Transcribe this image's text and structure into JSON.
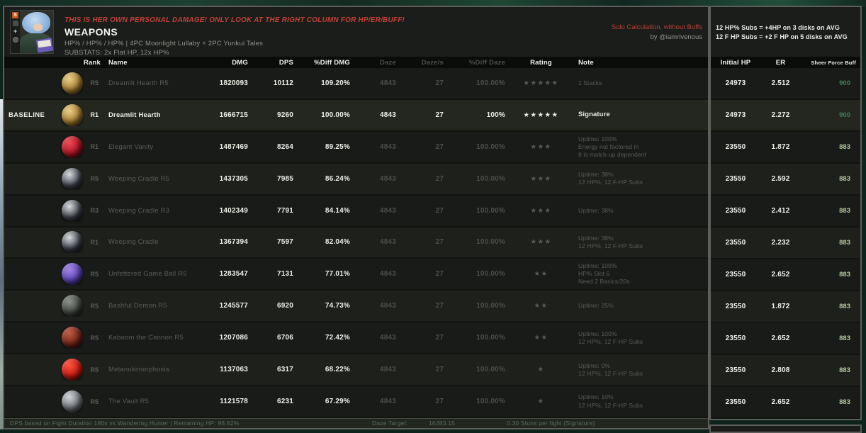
{
  "header": {
    "warning": "THIS IS HER OWN PERSONAL DAMAGE! ONLY LOOK AT THE RIGHT COLUMN FOR HP/ER/BUFF!",
    "title": "WEAPONS",
    "build_line": "HP% / HP% / HP%   |   4PC Moonlight Lullaby + 2PC Yunkui Tales",
    "substats_line": "SUBSTATS: 2x Flat HP, 12x HP%",
    "solo_note": "Solo Calculation, without Buffs",
    "credit": "by @iamrivenous",
    "avatar_badge": "S"
  },
  "right_panel": {
    "notes": [
      "12 HP% Subs = +4HP on 3 disks on AVG",
      "12 F HP Subs = +2 F HP on 5 disks on AVG"
    ],
    "columns": [
      "Initial HP",
      "ER",
      "Sheer Force Buff"
    ]
  },
  "table": {
    "columns": [
      "Rank",
      "Name",
      "DMG",
      "DPS",
      "%Diff DMG",
      "Daze",
      "Daze/s",
      "%Diff Daze",
      "Rating",
      "Note"
    ],
    "baseline_label": "BASELINE",
    "rows": [
      {
        "rank": "R5",
        "name": "Dreamlit Hearth R5",
        "dmg": "1820093",
        "dps": "10112",
        "diff_dmg": "109.20%",
        "daze": "4843",
        "daze_s": "27",
        "diff_daze": "100.00%",
        "stars": 5,
        "note": [
          "1 Stacks"
        ],
        "initial_hp": "24973",
        "er": "2.512",
        "buff": "900",
        "icon": "gold-orb",
        "baseline": false
      },
      {
        "rank": "R1",
        "name": "Dreamlit Hearth",
        "dmg": "1666715",
        "dps": "9260",
        "diff_dmg": "100.00%",
        "daze": "4843",
        "daze_s": "27",
        "diff_daze": "100%",
        "stars": 5,
        "note": [
          "Signature"
        ],
        "initial_hp": "24973",
        "er": "2.272",
        "buff": "900",
        "icon": "gold-orb",
        "baseline": true
      },
      {
        "rank": "R1",
        "name": "Elegant Vanity",
        "dmg": "1487469",
        "dps": "8264",
        "diff_dmg": "89.25%",
        "daze": "4843",
        "daze_s": "27",
        "diff_daze": "100.00%",
        "stars": 3,
        "note": [
          "Uptime: 100%",
          "Energy not factored in",
          "It is match-up dependent"
        ],
        "initial_hp": "23550",
        "er": "1.872",
        "buff": "883",
        "icon": "red-gem",
        "baseline": false
      },
      {
        "rank": "R5",
        "name": "Weeping Cradle R5",
        "dmg": "1437305",
        "dps": "7985",
        "diff_dmg": "86.24%",
        "daze": "4843",
        "daze_s": "27",
        "diff_daze": "100.00%",
        "stars": 3,
        "note": [
          "Uptime: 38%",
          "12 HP%, 12 F-HP Subs"
        ],
        "initial_hp": "23550",
        "er": "2.592",
        "buff": "883",
        "icon": "dark-orb",
        "baseline": false
      },
      {
        "rank": "R3",
        "name": "Weeping Cradle R3",
        "dmg": "1402349",
        "dps": "7791",
        "diff_dmg": "84.14%",
        "daze": "4843",
        "daze_s": "27",
        "diff_daze": "100.00%",
        "stars": 3,
        "note": [
          "Uptime: 38%"
        ],
        "initial_hp": "23550",
        "er": "2.412",
        "buff": "883",
        "icon": "dark-orb",
        "baseline": false
      },
      {
        "rank": "R1",
        "name": "Weeping Cradle",
        "dmg": "1367394",
        "dps": "7597",
        "diff_dmg": "82.04%",
        "daze": "4843",
        "daze_s": "27",
        "diff_daze": "100.00%",
        "stars": 3,
        "note": [
          "Uptime: 38%",
          "12 HP%, 12 F-HP Subs"
        ],
        "initial_hp": "23550",
        "er": "2.232",
        "buff": "883",
        "icon": "dark-orb",
        "baseline": false
      },
      {
        "rank": "R5",
        "name": "Unfettered Game Ball R5",
        "dmg": "1283547",
        "dps": "7131",
        "diff_dmg": "77.01%",
        "daze": "4843",
        "daze_s": "27",
        "diff_daze": "100.00%",
        "stars": 2,
        "note": [
          "Uptime: 100%",
          "HP% Slot 6",
          "Need 2 Basics/20s"
        ],
        "initial_hp": "23550",
        "er": "2.652",
        "buff": "883",
        "icon": "purple-ball",
        "baseline": false
      },
      {
        "rank": "R5",
        "name": "Bashful Demon R5",
        "dmg": "1245577",
        "dps": "6920",
        "diff_dmg": "74.73%",
        "daze": "4843",
        "daze_s": "27",
        "diff_daze": "100.00%",
        "stars": 2,
        "note": [
          "Uptime: 25%"
        ],
        "initial_hp": "23550",
        "er": "1.872",
        "buff": "883",
        "icon": "gray-mech",
        "baseline": false
      },
      {
        "rank": "R5",
        "name": "Kaboom the Cannon R5",
        "dmg": "1207086",
        "dps": "6706",
        "diff_dmg": "72.42%",
        "daze": "4843",
        "daze_s": "27",
        "diff_daze": "100.00%",
        "stars": 2,
        "note": [
          "Uptime: 100%",
          "12 HP%, 12 F-HP Subs"
        ],
        "initial_hp": "23550",
        "er": "2.652",
        "buff": "883",
        "icon": "dark-cannon",
        "baseline": false
      },
      {
        "rank": "R5",
        "name": "Metanukimorphosis",
        "dmg": "1137063",
        "dps": "6317",
        "diff_dmg": "68.22%",
        "daze": "4843",
        "daze_s": "27",
        "diff_daze": "100.00%",
        "stars": 1,
        "note": [
          "Uptime: 0%",
          "12 HP%, 12 F-HP Subs"
        ],
        "initial_hp": "23550",
        "er": "2.808",
        "buff": "883",
        "icon": "red-apple",
        "baseline": false
      },
      {
        "rank": "R5",
        "name": "The Vault R5",
        "dmg": "1121578",
        "dps": "6231",
        "diff_dmg": "67.29%",
        "daze": "4843",
        "daze_s": "27",
        "diff_daze": "100.00%",
        "stars": 1,
        "note": [
          "Uptime: 10%",
          "12 HP%, 12 F-HP Subs"
        ],
        "initial_hp": "23550",
        "er": "2.652",
        "buff": "883",
        "icon": "silver-vault",
        "baseline": false
      }
    ]
  },
  "footer": {
    "left": "DPS based on Fight Duration 180s vs Wandering Hunter | Remaining HP: 98.62%",
    "daze_target_label": "Daze Target:",
    "daze_target_value": "16283.15",
    "stuns": "0.30  Stuns per fight (Signature)"
  },
  "colors": {
    "accent_red": "#c04238",
    "buff_dark_green": "#40805c",
    "buff_light_green": "#b5c79e",
    "star_symbol": "★"
  },
  "icon_colors": {
    "gold-orb": [
      "#ecd087",
      "#a47c32",
      "#53380f"
    ],
    "red-gem": [
      "#ef4a57",
      "#ad1422",
      "#450910"
    ],
    "dark-orb": [
      "#d9dde1",
      "#3b3f49",
      "#14161c"
    ],
    "purple-ball": [
      "#a289e5",
      "#5c41b1",
      "#271c52"
    ],
    "gray-mech": [
      "#8d938b",
      "#40453f",
      "#1a1d1a"
    ],
    "dark-cannon": [
      "#c25d42",
      "#6f2119",
      "#270d09"
    ],
    "red-apple": [
      "#ff5443",
      "#c41a11",
      "#570a06"
    ],
    "silver-vault": [
      "#d3d7db",
      "#6c7076",
      "#2b2f35"
    ]
  }
}
